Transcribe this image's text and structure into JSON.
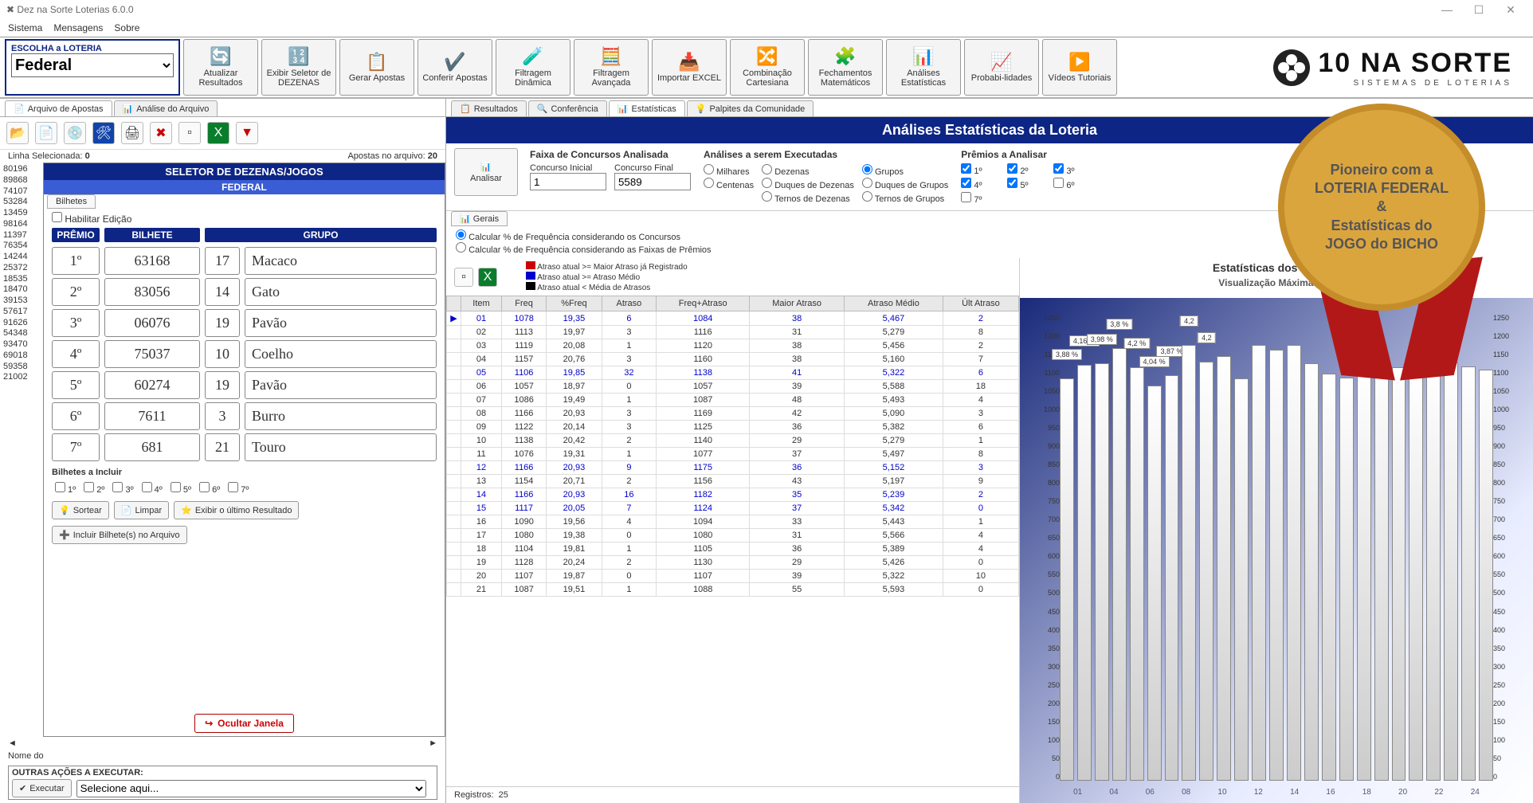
{
  "window": {
    "title": "Dez na Sorte Loterias 6.0.0",
    "menu": [
      "Sistema",
      "Mensagens",
      "Sobre"
    ]
  },
  "lottery_selector": {
    "label": "ESCOLHA a LOTERIA",
    "value": "Federal"
  },
  "toolbar": [
    {
      "glyph": "🔄",
      "label": "Atualizar Resultados"
    },
    {
      "glyph": "🔢",
      "label": "Exibir Seletor de DEZENAS"
    },
    {
      "glyph": "📋",
      "label": "Gerar Apostas"
    },
    {
      "glyph": "✔️",
      "label": "Conferir Apostas"
    },
    {
      "glyph": "🧪",
      "label": "Filtragem Dinâmica"
    },
    {
      "glyph": "🧮",
      "label": "Filtragem Avançada"
    },
    {
      "glyph": "📥",
      "label": "Importar EXCEL"
    },
    {
      "glyph": "🔀",
      "label": "Combinação Cartesiana"
    },
    {
      "glyph": "🧩",
      "label": "Fechamentos Matemáticos"
    },
    {
      "glyph": "📊",
      "label": "Análises Estatísticas"
    },
    {
      "glyph": "📈",
      "label": "Probabi-lidades"
    },
    {
      "glyph": "▶️",
      "label": "Vídeos Tutoriais"
    }
  ],
  "brand": {
    "title": "10 NA SORTE",
    "sub": "SISTEMAS DE LOTERIAS"
  },
  "left": {
    "tabs": [
      "Arquivo de Apostas",
      "Análise do Arquivo"
    ],
    "status": {
      "linha_lbl": "Linha Selecionada:",
      "linha_val": "0",
      "apostas_lbl": "Apostas no arquivo:",
      "apostas_val": "20"
    },
    "numbers": [
      "80196",
      "89868",
      "74107",
      "53284",
      "13459",
      "98164",
      "11397",
      "76354",
      "14244",
      "25372",
      "18535",
      "18470",
      "39153",
      "57617",
      "91626",
      "54348",
      "93470",
      "69018",
      "59358",
      "21002"
    ],
    "seletor": {
      "title": "SELETOR DE DEZENAS/JOGOS",
      "sub": "FEDERAL",
      "tab": "Bilhetes",
      "habilitar": "Habilitar Edição",
      "headers": [
        "PRÊMIO",
        "BILHETE",
        "GRUPO"
      ],
      "rows": [
        {
          "p": "1º",
          "b": "63168",
          "g": "17",
          "a": "Macaco"
        },
        {
          "p": "2º",
          "b": "83056",
          "g": "14",
          "a": "Gato"
        },
        {
          "p": "3º",
          "b": "06076",
          "g": "19",
          "a": "Pavão"
        },
        {
          "p": "4º",
          "b": "75037",
          "g": "10",
          "a": "Coelho"
        },
        {
          "p": "5º",
          "b": "60274",
          "g": "19",
          "a": "Pavão"
        },
        {
          "p": "6º",
          "b": "7611",
          "g": "3",
          "a": "Burro"
        },
        {
          "p": "7º",
          "b": "681",
          "g": "21",
          "a": "Touro"
        }
      ],
      "incluir_lbl": "Bilhetes a Incluir",
      "incluir": [
        "1º",
        "2º",
        "3º",
        "4º",
        "5º",
        "6º",
        "7º"
      ],
      "btns": {
        "sortear": "Sortear",
        "limpar": "Limpar",
        "exibir": "Exibir o último Resultado",
        "incluir": "Incluir Bilhete(s) no Arquivo",
        "ocultar": "Ocultar Janela"
      }
    },
    "nomedo": "Nome do",
    "outras": {
      "lbl": "OUTRAS AÇÕES A EXECUTAR:",
      "executar": "Executar",
      "placeholder": "Selecione aqui..."
    }
  },
  "right": {
    "tabs": [
      "Resultados",
      "Conferência",
      "Estatísticas",
      "Palpites da Comunidade"
    ],
    "active_tab": 2,
    "title": "Análises Estatísticas da Loteria",
    "analisar": "Analisar",
    "faixa": {
      "title": "Faixa de Concursos Analisada",
      "ini_lbl": "Concurso Inicial",
      "ini": "1",
      "fin_lbl": "Concurso Final",
      "fin": "5589"
    },
    "analises": {
      "title": "Análises a serem Executadas",
      "col1": [
        "Milhares",
        "Centenas"
      ],
      "col2": [
        "Dezenas",
        "Duques de Dezenas",
        "Ternos de Dezenas"
      ],
      "col3": [
        "Grupos",
        "Duques de Grupos",
        "Ternos de Grupos"
      ],
      "selected": "Grupos"
    },
    "premios": {
      "title": "Prêmios a Analisar",
      "items": [
        "1º",
        "2º",
        "3º",
        "4º",
        "5º",
        "6º",
        "7º"
      ],
      "checked": [
        "1º",
        "2º",
        "3º",
        "4º",
        "5º"
      ]
    },
    "subtab": "Gerais",
    "freq_opts": [
      "Calcular % de Frequência considerando os Concursos",
      "Calcular % de Frequência considerando as Faixas de Prêmios"
    ],
    "legend": [
      {
        "color": "#c00",
        "text": "Atraso atual >= Maior Atraso já Registrado"
      },
      {
        "color": "#00c",
        "text": "Atraso atual >= Atraso Médio"
      },
      {
        "color": "#000",
        "text": "Atraso atual < Média de Atrasos"
      }
    ],
    "table": {
      "headers": [
        "Item",
        "Freq",
        "%Freq",
        "Atraso",
        "Freq+Atraso",
        "Maior Atraso",
        "Atraso Médio",
        "Últ Atraso"
      ],
      "rows": [
        {
          "c": "blue",
          "v": [
            "01",
            "1078",
            "19,35",
            "6",
            "1084",
            "38",
            "5,467",
            "2"
          ]
        },
        {
          "c": "",
          "v": [
            "02",
            "1113",
            "19,97",
            "3",
            "1116",
            "31",
            "5,279",
            "8"
          ]
        },
        {
          "c": "",
          "v": [
            "03",
            "1119",
            "20,08",
            "1",
            "1120",
            "38",
            "5,456",
            "2"
          ]
        },
        {
          "c": "",
          "v": [
            "04",
            "1157",
            "20,76",
            "3",
            "1160",
            "38",
            "5,160",
            "7"
          ]
        },
        {
          "c": "blue",
          "v": [
            "05",
            "1106",
            "19,85",
            "32",
            "1138",
            "41",
            "5,322",
            "6"
          ]
        },
        {
          "c": "",
          "v": [
            "06",
            "1057",
            "18,97",
            "0",
            "1057",
            "39",
            "5,588",
            "18"
          ]
        },
        {
          "c": "",
          "v": [
            "07",
            "1086",
            "19,49",
            "1",
            "1087",
            "48",
            "5,493",
            "4"
          ]
        },
        {
          "c": "",
          "v": [
            "08",
            "1166",
            "20,93",
            "3",
            "1169",
            "42",
            "5,090",
            "3"
          ]
        },
        {
          "c": "",
          "v": [
            "09",
            "1122",
            "20,14",
            "3",
            "1125",
            "36",
            "5,382",
            "6"
          ]
        },
        {
          "c": "",
          "v": [
            "10",
            "1138",
            "20,42",
            "2",
            "1140",
            "29",
            "5,279",
            "1"
          ]
        },
        {
          "c": "",
          "v": [
            "11",
            "1076",
            "19,31",
            "1",
            "1077",
            "37",
            "5,497",
            "8"
          ]
        },
        {
          "c": "blue",
          "v": [
            "12",
            "1166",
            "20,93",
            "9",
            "1175",
            "36",
            "5,152",
            "3"
          ]
        },
        {
          "c": "",
          "v": [
            "13",
            "1154",
            "20,71",
            "2",
            "1156",
            "43",
            "5,197",
            "9"
          ]
        },
        {
          "c": "blue",
          "v": [
            "14",
            "1166",
            "20,93",
            "16",
            "1182",
            "35",
            "5,239",
            "2"
          ]
        },
        {
          "c": "blue",
          "v": [
            "15",
            "1117",
            "20,05",
            "7",
            "1124",
            "37",
            "5,342",
            "0"
          ]
        },
        {
          "c": "",
          "v": [
            "16",
            "1090",
            "19,56",
            "4",
            "1094",
            "33",
            "5,443",
            "1"
          ]
        },
        {
          "c": "",
          "v": [
            "17",
            "1080",
            "19,38",
            "0",
            "1080",
            "31",
            "5,566",
            "4"
          ]
        },
        {
          "c": "",
          "v": [
            "18",
            "1104",
            "19,81",
            "1",
            "1105",
            "36",
            "5,389",
            "4"
          ]
        },
        {
          "c": "",
          "v": [
            "19",
            "1128",
            "20,24",
            "2",
            "1130",
            "29",
            "5,426",
            "0"
          ]
        },
        {
          "c": "",
          "v": [
            "20",
            "1107",
            "19,87",
            "0",
            "1107",
            "39",
            "5,322",
            "10"
          ]
        },
        {
          "c": "",
          "v": [
            "21",
            "1087",
            "19,51",
            "1",
            "1088",
            "55",
            "5,593",
            "0"
          ]
        }
      ],
      "registros_lbl": "Registros:",
      "registros": "25"
    },
    "chart": {
      "title": "Estatísticas dos Grupos",
      "sub": "Visualização Máxima: Até",
      "labels_pct": [
        "3,88 %",
        "4,16 %",
        "3,98 %",
        "3,8 %",
        "4,2 %",
        "4,04 %",
        "3,87 %",
        "4,2",
        "4,2"
      ]
    }
  },
  "badge": {
    "lines": [
      "Pioneiro com a",
      "LOTERIA FEDERAL",
      "&",
      "Estatísticas do",
      "JOGO do BICHO"
    ]
  },
  "chart_data": {
    "type": "bar",
    "title": "Estatísticas dos Grupos",
    "xlabel": "Item",
    "ylabel": "Freq",
    "categories": [
      "01",
      "02",
      "03",
      "04",
      "05",
      "06",
      "07",
      "08",
      "09",
      "10",
      "11",
      "12",
      "13",
      "14",
      "15",
      "16",
      "17",
      "18",
      "19",
      "20",
      "21",
      "22",
      "23",
      "24",
      "25"
    ],
    "values": [
      1078,
      1113,
      1119,
      1157,
      1106,
      1057,
      1086,
      1166,
      1122,
      1138,
      1076,
      1166,
      1154,
      1166,
      1117,
      1090,
      1080,
      1104,
      1128,
      1107,
      1087,
      1100,
      1120,
      1110,
      1100
    ],
    "ylim": [
      0,
      1250
    ],
    "yticks_left": [
      1250,
      1200,
      1150,
      1100,
      1050,
      1000,
      950,
      900,
      850,
      800,
      750,
      700,
      650,
      600,
      550,
      500,
      450,
      400,
      350,
      300,
      250,
      200,
      150,
      100,
      50,
      0
    ],
    "yticks_right": [
      1250,
      1200,
      1150,
      1100,
      1050,
      1000,
      950,
      900,
      850,
      800,
      750,
      700,
      650,
      600,
      550,
      500,
      450,
      400,
      350,
      300,
      250,
      200,
      150,
      100,
      50,
      0
    ],
    "xticks": [
      "01",
      "04",
      "06",
      "08",
      "10",
      "12",
      "14",
      "16",
      "18",
      "20",
      "22",
      "24"
    ]
  }
}
